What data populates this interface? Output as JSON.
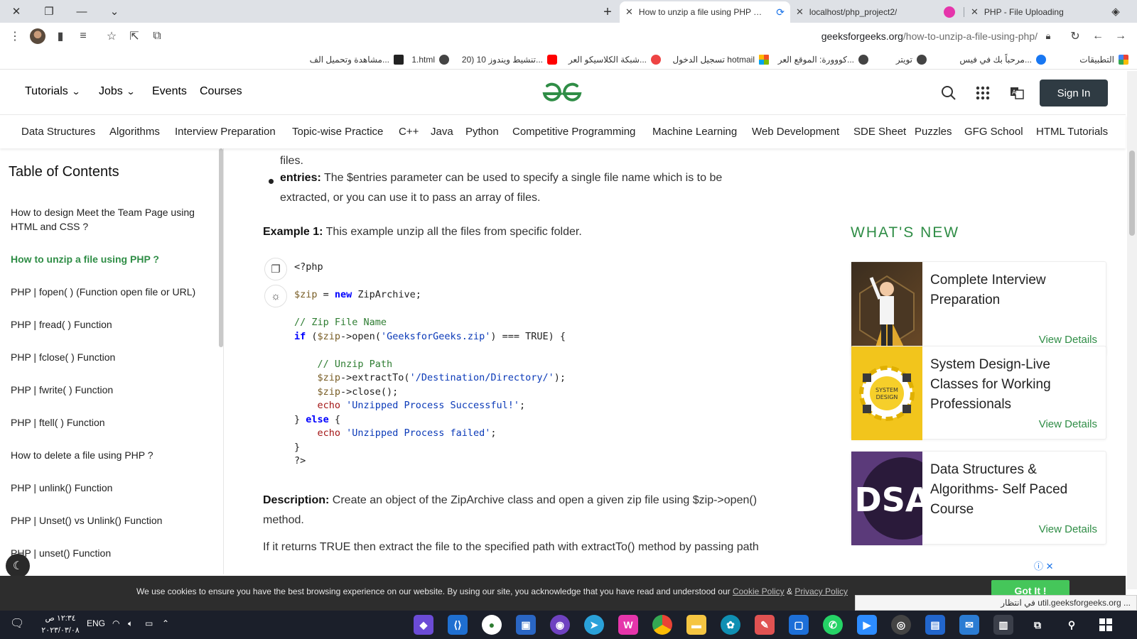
{
  "browser": {
    "tabs": [
      {
        "title": "How to unzip a file using PHP ? - ",
        "active": true
      },
      {
        "title": "localhost/php_project2/",
        "active": false
      },
      {
        "title": "PHP - File Uploading",
        "active": false
      }
    ],
    "url_host": "geeksforgeeks.org",
    "url_path": "/how-to-unzip-a-file-using-php/",
    "bookmarks": [
      "التطبيقات",
      "مرحباً بك في فيس...",
      "تويتر",
      "كووورة: الموقع العر...",
      "تسجيل الدخول hotmail",
      "شبكة الكلاسيكو العر...",
      "تنشيط ويندوز 10 (20...",
      "1.html",
      "مشاهدة وتحميل الف..."
    ]
  },
  "header": {
    "nav": [
      "Tutorials",
      "Jobs",
      "Events",
      "Courses"
    ],
    "logo_text": "GfG",
    "sign_in": "Sign In"
  },
  "categories": [
    "Data Structures",
    "Algorithms",
    "Interview Preparation",
    "Topic-wise Practice",
    "C++",
    "Java",
    "Python",
    "Competitive Programming",
    "Machine Learning",
    "Web Development",
    "SDE Sheet",
    "Puzzles",
    "GFG School",
    "HTML Tutorials"
  ],
  "toc": {
    "title": "Table of Contents",
    "items": [
      "How to design Meet the Team Page using HTML and CSS ?",
      "How to unzip a file using PHP ?",
      "PHP | fopen( ) (Function open file or URL)",
      "PHP | fread( ) Function",
      "PHP | fclose( ) Function",
      "PHP | fwrite( ) Function",
      "PHP | ftell( ) Function",
      "How to delete a file using PHP ?",
      "PHP | unlink() Function",
      "PHP | Unset() vs Unlink() Function",
      "PHP | unset() Function"
    ]
  },
  "article": {
    "top_fragment": "files.",
    "entries_label": "entries:",
    "entries_text": " The $entries parameter can be used to specify a single file name which is to be extracted, or you can use it to pass an array of files.",
    "example_label": "Example 1:",
    "example_text": " This example unzip all the files from specific folder.",
    "description_label": "Description:",
    "description_text": " Create an object of the ZipArchive class and open a given zip file using $zip->open() method.",
    "last_para": "If it returns TRUE then extract the file to the specified path with extractTo() method by passing path"
  },
  "code_lines": [
    "<?php",
    "",
    "$zip = new ZipArchive;",
    "",
    "// Zip File Name",
    "if ($zip->open('GeeksforGeeks.zip') === TRUE) {",
    "",
    "    // Unzip Path",
    "    $zip->extractTo('/Destination/Directory/');",
    "    $zip->close();",
    "    echo 'Unzipped Process Successful!';",
    "} else {",
    "    echo 'Unzipped Process failed';",
    "}",
    "?>"
  ],
  "whats_new": {
    "heading": "WHAT'S NEW",
    "cards": [
      {
        "title": "Complete Interview Preparation",
        "link": "View Details"
      },
      {
        "title": "System Design-Live Classes for Working Professionals",
        "link": "View Details",
        "thumb_text": "SYSTEM DESIGN"
      },
      {
        "title": "Data Structures & Algorithms- Self Paced Course",
        "link": "View Details",
        "thumb_text": "DSA"
      }
    ]
  },
  "cookie": {
    "text": "We use cookies to ensure you have the best browsing experience on our website. By using our site, you acknowledge that you have read and understood our ",
    "cookie_policy": "Cookie Policy",
    "amp": " & ",
    "privacy_policy": "Privacy Policy",
    "button": "Got It !",
    "status": "في انتظار util.geeksforgeeks.org ..."
  },
  "taskbar": {
    "time": "١٢:٣٤ ص",
    "date": "٢٠٢٣/٠٣/٠٨",
    "lang": "ENG"
  },
  "colors": {
    "gfg_green": "#2f8d46",
    "signin_bg": "#2f3b43",
    "gotit_bg": "#45c65a"
  }
}
